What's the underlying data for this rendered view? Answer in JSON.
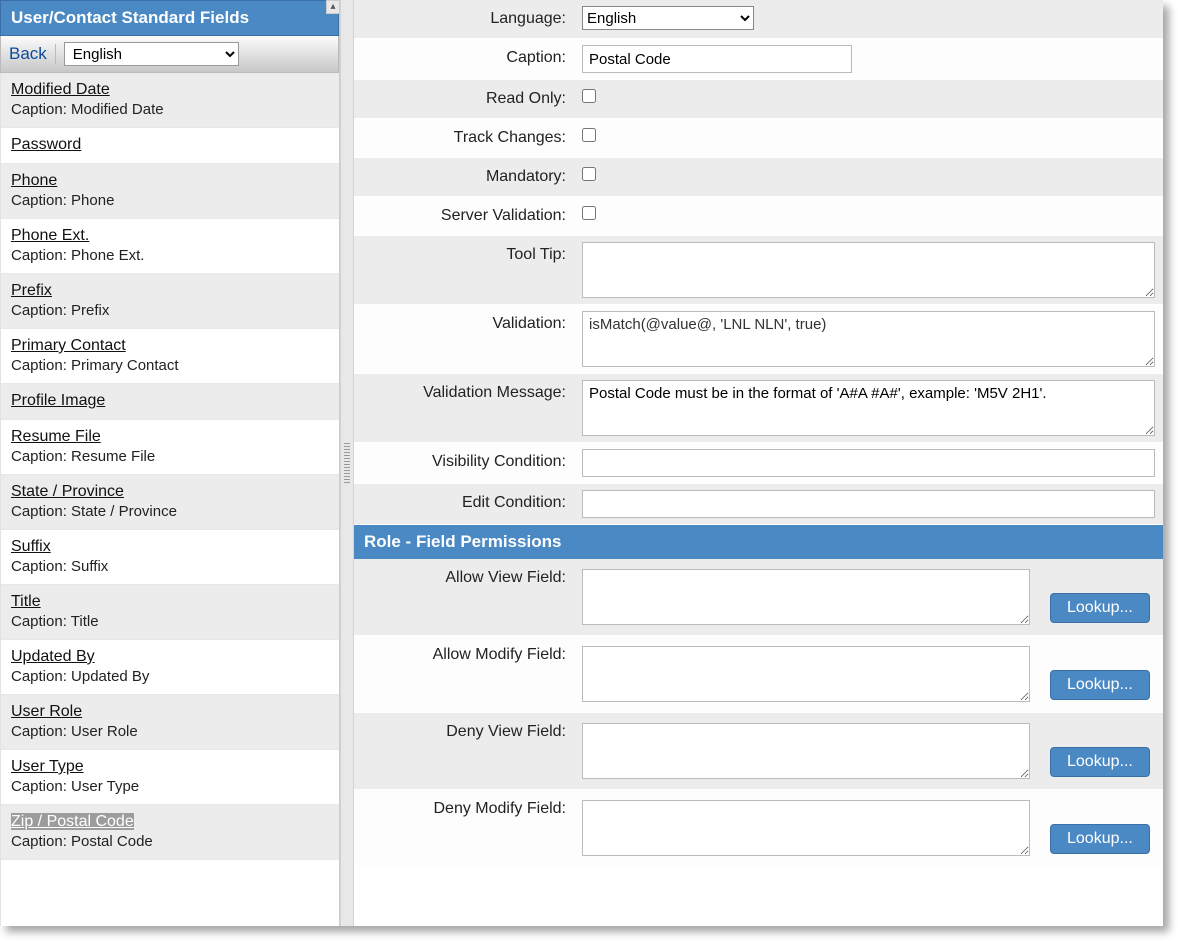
{
  "sidebar": {
    "title": "User/Contact Standard Fields",
    "back": "Back",
    "language_options": [
      "English"
    ],
    "language_value": "English",
    "fields": [
      {
        "name": "Modified Date",
        "caption": "Caption: Modified Date",
        "alt": true
      },
      {
        "name": "Password",
        "caption": "",
        "alt": false
      },
      {
        "name": "Phone",
        "caption": "Caption: Phone",
        "alt": true
      },
      {
        "name": "Phone Ext.",
        "caption": "Caption: Phone Ext.",
        "alt": false
      },
      {
        "name": "Prefix",
        "caption": "Caption: Prefix",
        "alt": true
      },
      {
        "name": "Primary Contact",
        "caption": "Caption: Primary Contact",
        "alt": false
      },
      {
        "name": "Profile Image",
        "caption": "",
        "alt": true
      },
      {
        "name": "Resume File",
        "caption": "Caption: Resume File",
        "alt": false
      },
      {
        "name": "State / Province",
        "caption": "Caption: State / Province",
        "alt": true
      },
      {
        "name": "Suffix",
        "caption": "Caption: Suffix",
        "alt": false
      },
      {
        "name": "Title",
        "caption": "Caption: Title",
        "alt": true
      },
      {
        "name": "Updated By",
        "caption": "Caption: Updated By",
        "alt": false
      },
      {
        "name": "User Role",
        "caption": "Caption: User Role",
        "alt": true
      },
      {
        "name": "User Type",
        "caption": "Caption: User Type",
        "alt": false
      },
      {
        "name": "Zip / Postal Code",
        "caption": "Caption: Postal Code",
        "alt": true,
        "selected": true
      }
    ]
  },
  "form": {
    "language_label": "Language:",
    "language_value": "English",
    "caption_label": "Caption:",
    "caption_value": "Postal Code",
    "readonly_label": "Read Only:",
    "readonly_value": false,
    "track_label": "Track Changes:",
    "track_value": false,
    "mandatory_label": "Mandatory:",
    "mandatory_value": false,
    "server_label": "Server Validation:",
    "server_value": false,
    "tooltip_label": "Tool Tip:",
    "tooltip_value": "",
    "validation_label": "Validation:",
    "validation_value": "isMatch(@value@, 'LNL NLN', true)",
    "validation_msg_label": "Validation Message:",
    "validation_msg_value": "Postal Code must be in the format of 'A#A #A#', example: 'M5V 2H1'.",
    "visibility_label": "Visibility Condition:",
    "visibility_value": "",
    "edit_label": "Edit Condition:",
    "edit_value": ""
  },
  "permissions": {
    "header": "Role - Field Permissions",
    "allow_view_label": "Allow View Field:",
    "allow_view_value": "",
    "allow_modify_label": "Allow Modify Field:",
    "allow_modify_value": "",
    "deny_view_label": "Deny View Field:",
    "deny_view_value": "",
    "deny_modify_label": "Deny Modify Field:",
    "deny_modify_value": "",
    "lookup": "Lookup..."
  }
}
